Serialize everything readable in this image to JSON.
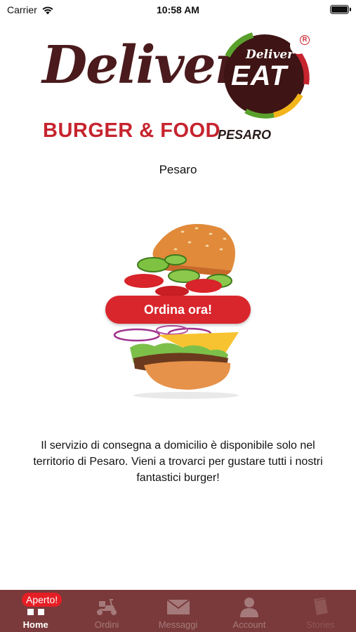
{
  "status_bar": {
    "carrier": "Carrier",
    "time": "10:58 AM"
  },
  "logo": {
    "title": "Deliver",
    "subtitle": "BURGER & FOOD",
    "location": "PESARO",
    "badge_top": "Deliver",
    "badge_main": "EAT",
    "registered": "R"
  },
  "city": "Pesaro",
  "order_button": "Ordina ora!",
  "info_text": "Il servizio di consegna a domicilio è disponibile solo nel territorio di Pesaro. Vieni a trovarci per gustare tutti i nostri fantastici burger!",
  "tabs": [
    {
      "label": "Home",
      "icon": "home-icon",
      "badge": "Aperto!",
      "active": true
    },
    {
      "label": "Ordini",
      "icon": "scooter-icon"
    },
    {
      "label": "Messaggi",
      "icon": "envelope-icon"
    },
    {
      "label": "Account",
      "icon": "person-icon"
    },
    {
      "label": "Stories",
      "icon": "book-icon"
    }
  ],
  "colors": {
    "accent": "#d9262c",
    "tabbar": "#7a3a3b",
    "brand_dark": "#4a1a1c"
  }
}
